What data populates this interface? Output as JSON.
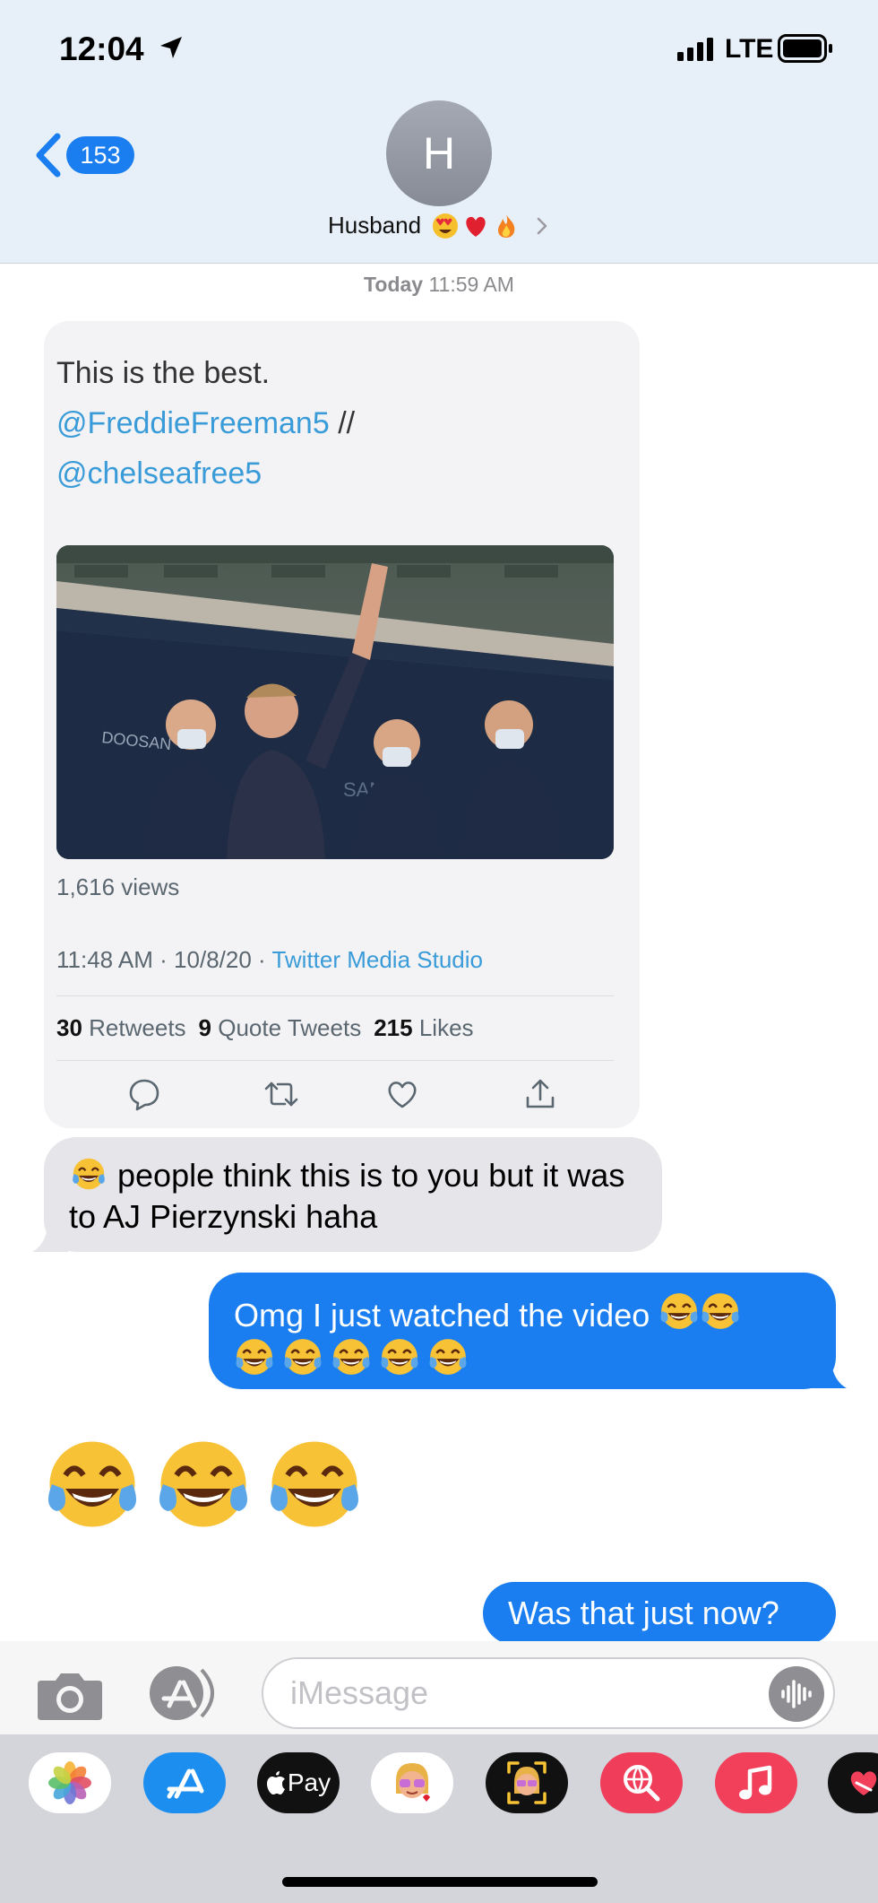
{
  "status_bar": {
    "time": "12:04",
    "network": "LTE"
  },
  "header": {
    "back_count": "153",
    "avatar_initial": "H",
    "contact_name": "Husband",
    "contact_emojis": [
      "heart-eyes-emoji",
      "red-heart-emoji",
      "fire-emoji"
    ]
  },
  "conversation": {
    "timestamp_day": "Today",
    "timestamp_time": "11:59 AM",
    "tweet": {
      "text": "This is the best.",
      "mention1": "@FreddieFreeman5",
      "separator": " //",
      "mention2": "@chelseafree5",
      "views": "1,616 views",
      "time": "11:48 AM",
      "dot1": " · ",
      "date": "10/8/20",
      "dot2": " · ",
      "source": "Twitter Media Studio",
      "retweets_count": "30",
      "retweets_label": "Retweets",
      "quotes_count": "9",
      "quotes_label": "Quote Tweets",
      "likes_count": "215",
      "likes_label": "Likes",
      "actions": [
        "reply-icon",
        "retweet-icon",
        "like-icon",
        "share-icon"
      ]
    },
    "messages": [
      {
        "from": "them",
        "text": " people think this is to you but it was to AJ Pierzynski haha"
      },
      {
        "from": "me",
        "text": "Omg I just watched the video "
      },
      {
        "from": "them",
        "text": ""
      },
      {
        "from": "me",
        "text": "Was that just now?"
      }
    ]
  },
  "composer": {
    "placeholder": "iMessage"
  },
  "app_drawer": {
    "apps": [
      "photos-app",
      "app-store-app",
      "apple-pay-app",
      "memoji-app",
      "animoji-app",
      "search-images-app",
      "music-app",
      "digital-touch-app"
    ],
    "apple_pay_label": "Pay"
  },
  "colors": {
    "imessage_blue": "#1a7ef0",
    "received_gray": "#e5e5ea",
    "twitter_blue": "#3a9bd9"
  }
}
